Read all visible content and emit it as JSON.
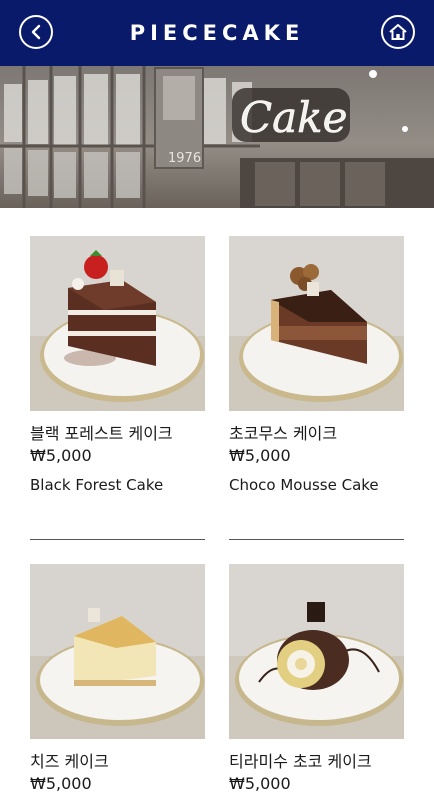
{
  "header": {
    "title": "PIECECAKE",
    "back_icon": "back-arrow-icon",
    "home_icon": "home-icon",
    "bar_color": "#0a1a6b"
  },
  "banner": {
    "sign_text": "Cake",
    "poster_text": "1976"
  },
  "products": [
    {
      "name_ko": "블랙 포레스트 케이크",
      "price": "₩5,000",
      "name_en": "Black Forest Cake"
    },
    {
      "name_ko": "초코무스 케이크",
      "price": "₩5,000",
      "name_en": "Choco Mousse Cake"
    },
    {
      "name_ko": "치즈 케이크",
      "price": "₩5,000",
      "name_en": ""
    },
    {
      "name_ko": "티라미수 초코 케이크",
      "price": "₩5,000",
      "name_en": ""
    }
  ]
}
